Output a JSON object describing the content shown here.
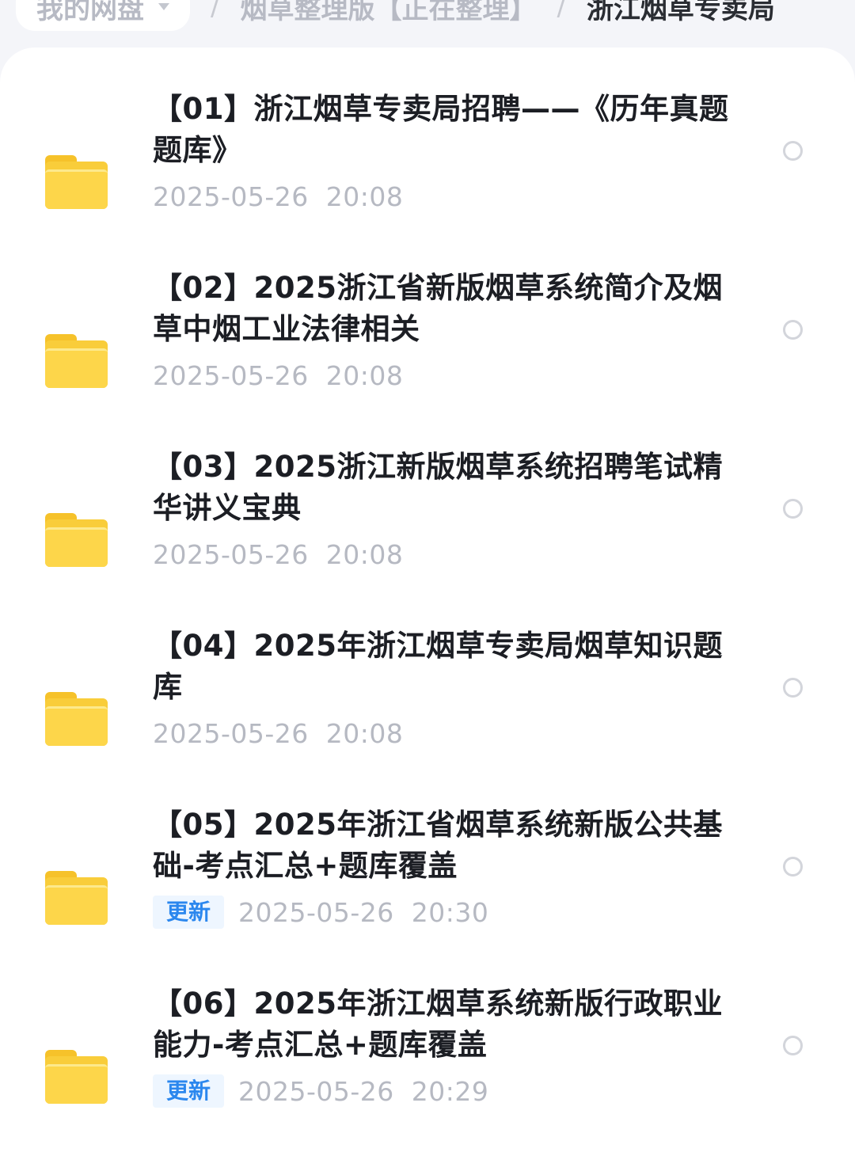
{
  "breadcrumb": {
    "root": "我的网盘",
    "middle": "烟草整理版【正在整理】",
    "current": "浙江烟草专卖局",
    "separator": "/"
  },
  "files": [
    {
      "title": "【01】浙江烟草专卖局招聘——《历年真题题库》",
      "badge": "",
      "date": "2025-05-26  20:08"
    },
    {
      "title": "【02】2025浙江省新版烟草系统简介及烟草中烟工业法律相关",
      "badge": "",
      "date": "2025-05-26  20:08"
    },
    {
      "title": "【03】2025浙江新版烟草系统招聘笔试精华讲义宝典",
      "badge": "",
      "date": "2025-05-26  20:08"
    },
    {
      "title": "【04】2025年浙江烟草专卖局烟草知识题库",
      "badge": "",
      "date": "2025-05-26  20:08"
    },
    {
      "title": "【05】2025年浙江省烟草系统新版公共基础-考点汇总+题库覆盖",
      "badge": "更新",
      "date": "2025-05-26  20:30"
    },
    {
      "title": "【06】2025年浙江烟草系统新版行政职业能力-考点汇总+题库覆盖",
      "badge": "更新",
      "date": "2025-05-26  20:29"
    }
  ],
  "icons": {
    "folder": "folder-icon",
    "select": "radio-circle-icon",
    "dropdown": "caret-down-icon"
  },
  "colors": {
    "folder": "#fdd64a",
    "badge_text": "#2b87ee",
    "badge_bg": "#eef6ff",
    "date": "#b6b9c2"
  }
}
